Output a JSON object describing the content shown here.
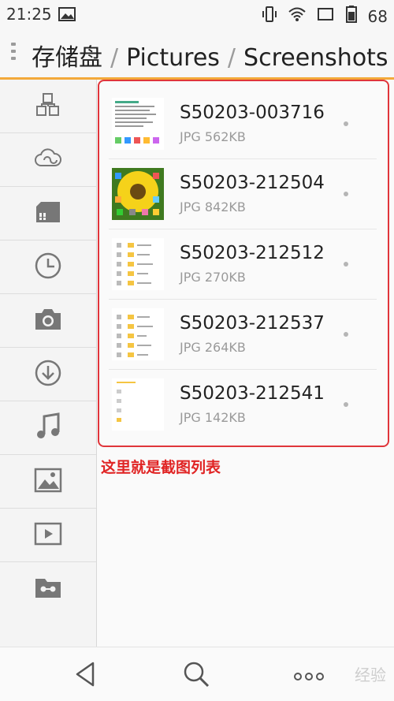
{
  "status_bar": {
    "time": "21:25",
    "battery": "68"
  },
  "header": {
    "breadcrumbs": [
      "存储盘",
      "Pictures",
      "Screenshots"
    ],
    "separator": "/"
  },
  "sidebar": {
    "items": [
      {
        "icon": "category-icon"
      },
      {
        "icon": "cloud-icon"
      },
      {
        "icon": "storage-icon"
      },
      {
        "icon": "recent-clock-icon"
      },
      {
        "icon": "camera-icon"
      },
      {
        "icon": "download-icon"
      },
      {
        "icon": "music-icon"
      },
      {
        "icon": "image-icon"
      },
      {
        "icon": "video-icon"
      },
      {
        "icon": "secure-folder-icon"
      }
    ]
  },
  "files": [
    {
      "name": "S50203-003716",
      "type": "JPG",
      "size": "562KB"
    },
    {
      "name": "S50203-212504",
      "type": "JPG",
      "size": "842KB"
    },
    {
      "name": "S50203-212512",
      "type": "JPG",
      "size": "270KB"
    },
    {
      "name": "S50203-212537",
      "type": "JPG",
      "size": "264KB"
    },
    {
      "name": "S50203-212541",
      "type": "JPG",
      "size": "142KB"
    }
  ],
  "annotation": "这里就是截图列表",
  "watermark": "经验",
  "colors": {
    "accent": "#f3a93a",
    "highlight": "#e0353a",
    "annotation": "#e02424"
  }
}
